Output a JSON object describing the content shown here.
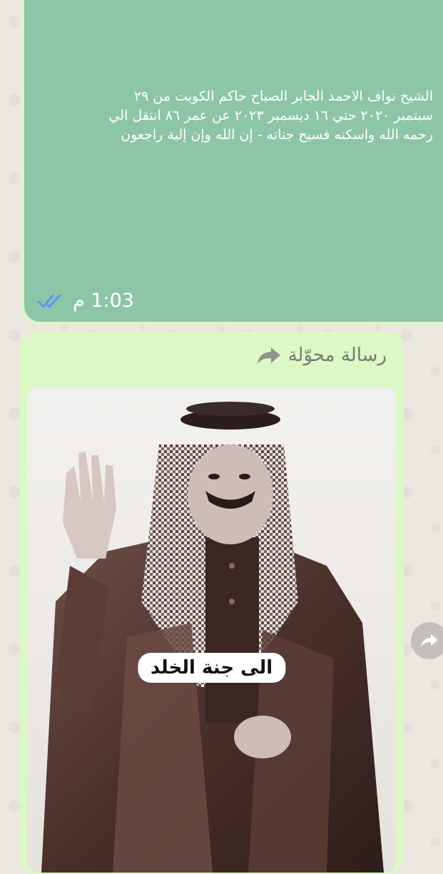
{
  "message": {
    "text": "الشيخ نواف الاحمد الجابر الصباح حاكم الكويت من ٢٩\nسبتمبر ٢٠٢٠ حتي ١٦ ديسمبر ٢٠٢٣ عن عمر ٨٦ انتقل الي\nرحمه الله واسكنه فسيح جناته - إن الله وإن إلية راجعون",
    "time": "1:03 م",
    "status_icon": "double-check-icon",
    "bubble_color": "#8dc6a6",
    "border_color": "#dff5c6"
  },
  "forwarded": {
    "label": "رسالة محوّلة",
    "icon": "forward-arrow-icon",
    "bubble_color": "#dcf8c6"
  },
  "image": {
    "overlay_text": "الى جنة الخلد",
    "style": "grayscale-sepia portrait photo"
  },
  "side_action": {
    "icon": "share-forward-icon"
  }
}
